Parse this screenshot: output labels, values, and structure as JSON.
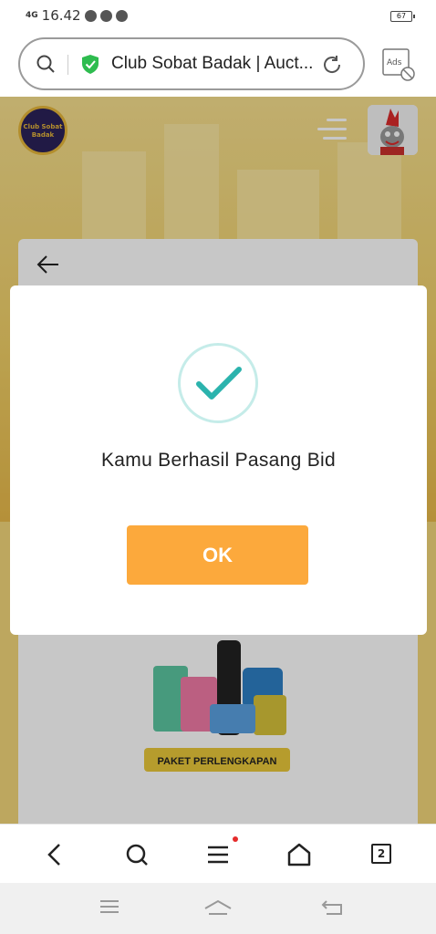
{
  "status_bar": {
    "signal": "4G",
    "time": "16.42",
    "battery": "67"
  },
  "address_bar": {
    "url_text": "Club Sobat Badak | Auct..."
  },
  "site": {
    "logo_text": "Club Sobat Badak"
  },
  "modal": {
    "message": "Kamu Berhasil Pasang Bid",
    "ok_label": "OK"
  },
  "product": {
    "label": "PAKET PERLENGKAPAN"
  },
  "browser_nav": {
    "tab_count": "2"
  },
  "colors": {
    "ok_button": "#fca93c",
    "check": "#2bb3ad",
    "secure_shield": "#2ebc4f",
    "hero": "#f0cf66"
  }
}
